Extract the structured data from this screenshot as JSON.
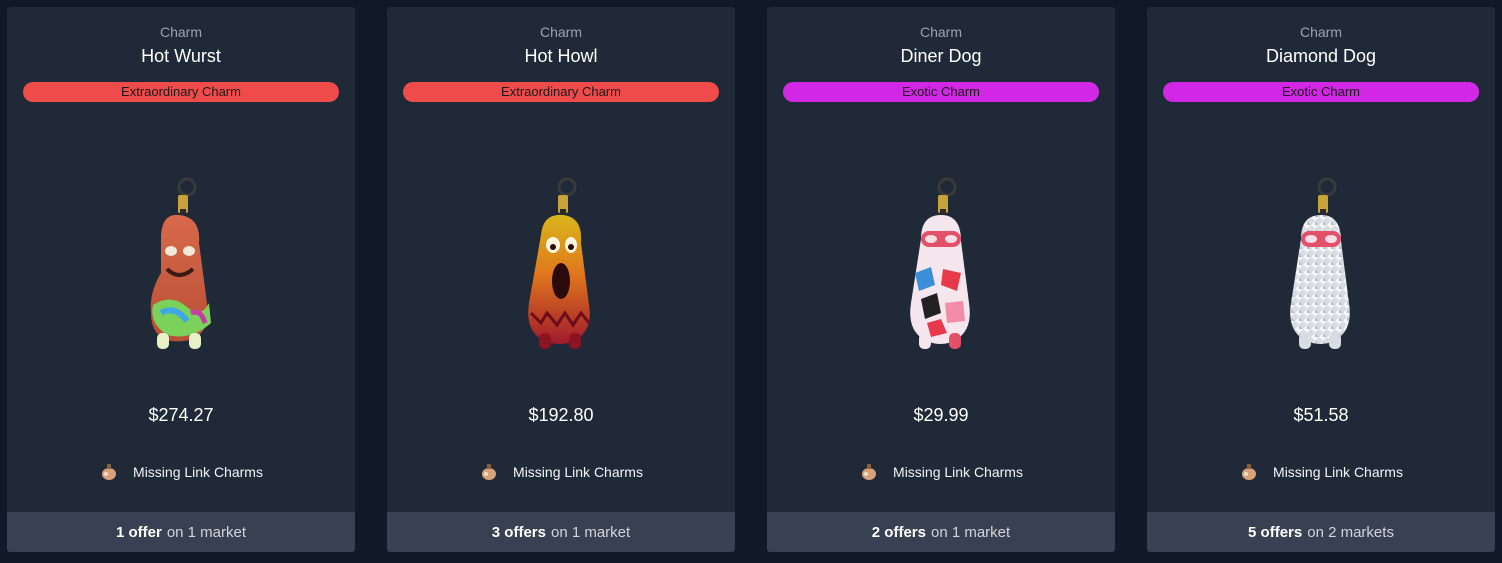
{
  "colors": {
    "extraordinary": "#ef4b4b",
    "exotic": "#d228e6"
  },
  "cards": [
    {
      "type": "Charm",
      "name": "Hot Wurst",
      "rarity": "Extraordinary Charm",
      "rarity_color": "#ef4b4b",
      "price": "$274.27",
      "collection": "Missing Link Charms",
      "collection_icon": "missing-link-icon",
      "offers": "1 offer",
      "markets": "on 1 market"
    },
    {
      "type": "Charm",
      "name": "Hot Howl",
      "rarity": "Extraordinary Charm",
      "rarity_color": "#ef4b4b",
      "price": "$192.80",
      "collection": "Missing Link Charms",
      "collection_icon": "missing-link-icon",
      "offers": "3 offers",
      "markets": "on 1 market"
    },
    {
      "type": "Charm",
      "name": "Diner Dog",
      "rarity": "Exotic Charm",
      "rarity_color": "#d228e6",
      "price": "$29.99",
      "collection": "Missing Link Charms",
      "collection_icon": "missing-link-icon",
      "offers": "2 offers",
      "markets": "on 1 market"
    },
    {
      "type": "Charm",
      "name": "Diamond Dog",
      "rarity": "Exotic Charm",
      "rarity_color": "#d228e6",
      "price": "$51.58",
      "collection": "Missing Link Charms",
      "collection_icon": "missing-link-icon",
      "offers": "5 offers",
      "markets": "on 2 markets"
    }
  ]
}
